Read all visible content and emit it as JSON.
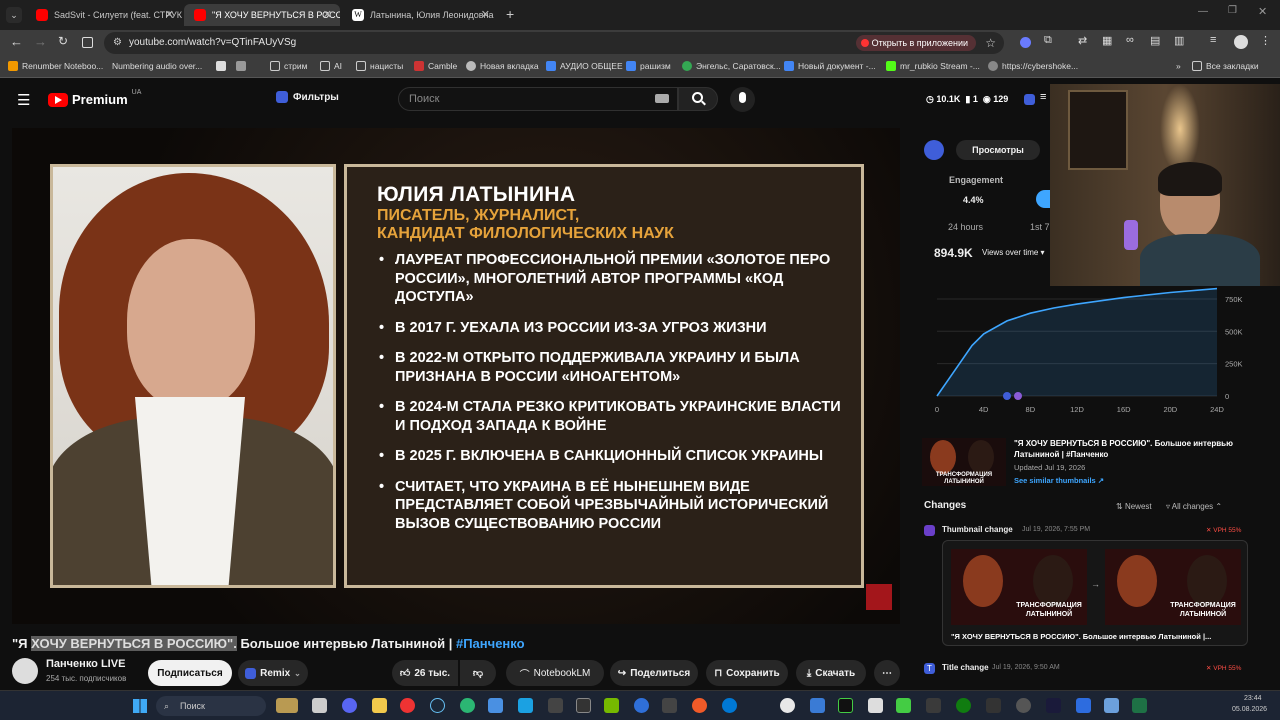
{
  "browser": {
    "tabs": [
      {
        "title": "SadSvit - Силуети (feat. СТРУК",
        "active": false
      },
      {
        "title": "\"Я ХОЧУ ВЕРНУТЬСЯ В РОССИ",
        "active": true
      },
      {
        "title": "Латынина, Юлия Леонидовна",
        "active": false
      }
    ],
    "url": "youtube.com/watch?v=QTinFAUyVSg",
    "open_in_app": "Открыть в приложении",
    "bookmarks": [
      "Renumber Noteboo...",
      "Numbering audio over...",
      "стрим",
      "AI",
      "нацисты",
      "Camble",
      "Новая вкладка",
      "АУДИО ОБЩЕЕ",
      "рашизм",
      "Энгельс, Саратовск...",
      "Новый документ -...",
      "mr_rubkio Stream -...",
      "https://cybershoke..."
    ],
    "all_bookmarks": "Все закладки"
  },
  "youtube": {
    "logo": "Premium",
    "region": "UA",
    "filters": "Фильтры",
    "search_placeholder": "Поиск"
  },
  "video_slide": {
    "name": "ЮЛИЯ ЛАТЫНИНА",
    "role_line1": "ПИСАТЕЛЬ, ЖУРНАЛИСТ,",
    "role_line2": "КАНДИДАТ ФИЛОЛОГИЧЕСКИХ НАУК",
    "bullets": [
      "ЛАУРЕАТ ПРОФЕССИОНАЛЬНОЙ ПРЕМИИ «ЗОЛОТОЕ ПЕРО РОССИИ», МНОГОЛЕТНИЙ АВТОР ПРОГРАММЫ «КОД ДОСТУПА»",
      "В 2017 Г. УЕХАЛА ИЗ РОССИИ ИЗ-ЗА УГРОЗ ЖИЗНИ",
      "В 2022-М ОТКРЫТО ПОДДЕРЖИВАЛА УКРАИНУ И БЫЛА ПРИЗНАНА В РОССИИ «ИНОАГЕНТОМ»",
      "В 2024-М СТАЛА РЕЗКО КРИТИКОВАТЬ УКРАИНСКИЕ ВЛАСТИ И ПОДХОД ЗАПАДА К ВОЙНЕ",
      "В 2025 Г. ВКЛЮЧЕНА В САНКЦИОННЫЙ СПИСОК УКРАИНЫ",
      "СЧИТАЕТ, ЧТО УКРАИНА В ЕЁ НЫНЕШНЕМ ВИДЕ ПРЕДСТАВЛЯЕТ СОБОЙ ЧРЕЗВЫЧАЙНЫЙ ИСТОРИЧЕСКИЙ ВЫЗОВ СУЩЕСТВОВАНИЮ РОССИИ"
    ]
  },
  "video_meta": {
    "title_prefix": "\"Я ",
    "title_highlight": "ХОЧУ ВЕРНУТЬСЯ В РОССИЮ\".",
    "title_rest": " Большое интервью Латыниной | ",
    "hashtag": "#Панченко",
    "channel": "Панченко LIVE",
    "subscribers": "254 тыс. подписчиков",
    "subscribe": "Подписаться",
    "remix": "Remix",
    "likes": "26 тыс.",
    "notebooklm": "NotebookLM",
    "share": "Поделиться",
    "save": "Сохранить",
    "download": "Скачать"
  },
  "extension": {
    "stats": {
      "views": "10.1K",
      "b": "1",
      "c": "129"
    },
    "tab_views": "Просмотры",
    "engagement_label": "Engagement",
    "engagement": "4.4%",
    "h24": "24 hours",
    "first7": "1st 7",
    "total_views": "894.9K",
    "views_dropdown": "Views over time",
    "y_ticks": [
      "750K",
      "500K",
      "250K",
      "0"
    ],
    "x_ticks": [
      "0",
      "4D",
      "8D",
      "12D",
      "16D",
      "20D",
      "24D"
    ],
    "card_title": "\"Я ХОЧУ ВЕРНУТЬСЯ В РОССИЮ\". Большое интервью Латыниной | #Панченко",
    "card_updated": "Updated Jul 19, 2026",
    "card_link": "See similar thumbnails",
    "thumb_caption": "ТРАНСФОРМАЦИЯ ЛАТЫНИНОЙ",
    "changes": "Changes",
    "newest": "Newest",
    "all_changes": "All changes",
    "change1_type": "Thumbnail change",
    "change1_date": "Jul 19, 2026, 7:55 PM",
    "change1_badge": "VPH 55%",
    "change1_caption": "\"Я ХОЧУ ВЕРНУТЬСЯ В РОССИЮ\". Большое интервью Латыниной |...",
    "change2_type": "Title change",
    "change2_date": "Jul 19, 2026, 9:50 AM",
    "change2_badge": "VPH 55%"
  },
  "chart_data": {
    "type": "area",
    "x": [
      0,
      1,
      2,
      3,
      4,
      6,
      8,
      10,
      12,
      16,
      20,
      24
    ],
    "values": [
      0,
      130000,
      260000,
      390000,
      480000,
      580000,
      640000,
      680000,
      710000,
      760000,
      800000,
      830000
    ],
    "xlabel": "",
    "ylabel": "",
    "ylim": [
      0,
      850000
    ],
    "xlim": [
      0,
      24
    ],
    "color": "#3ea6ff"
  },
  "taskbar": {
    "search": "Поиск",
    "time": "23:44",
    "date": "05.08.2026"
  }
}
